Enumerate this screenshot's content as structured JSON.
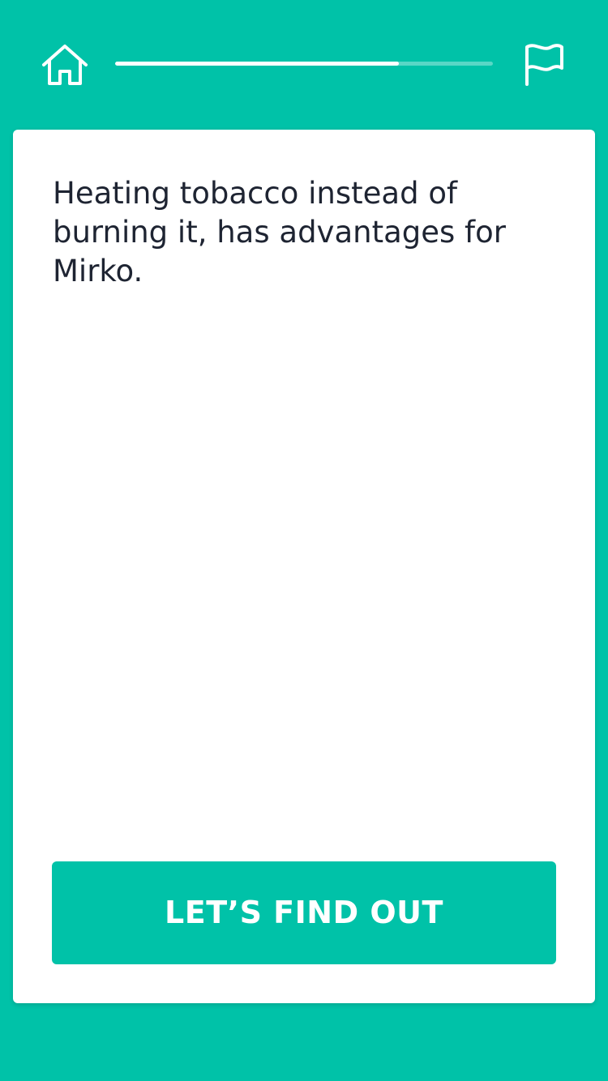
{
  "colors": {
    "background": "#00c2a8",
    "card": "#ffffff",
    "text": "#1e2432",
    "accent": "#00c2a8"
  },
  "header": {
    "home_icon": "home-icon",
    "flag_icon": "flag-icon",
    "progress_fraction": 0.75
  },
  "card": {
    "statement": "Heating tobacco instead of burning it, has advantages for Mirko.",
    "cta_label": "LET’S FIND OUT"
  }
}
